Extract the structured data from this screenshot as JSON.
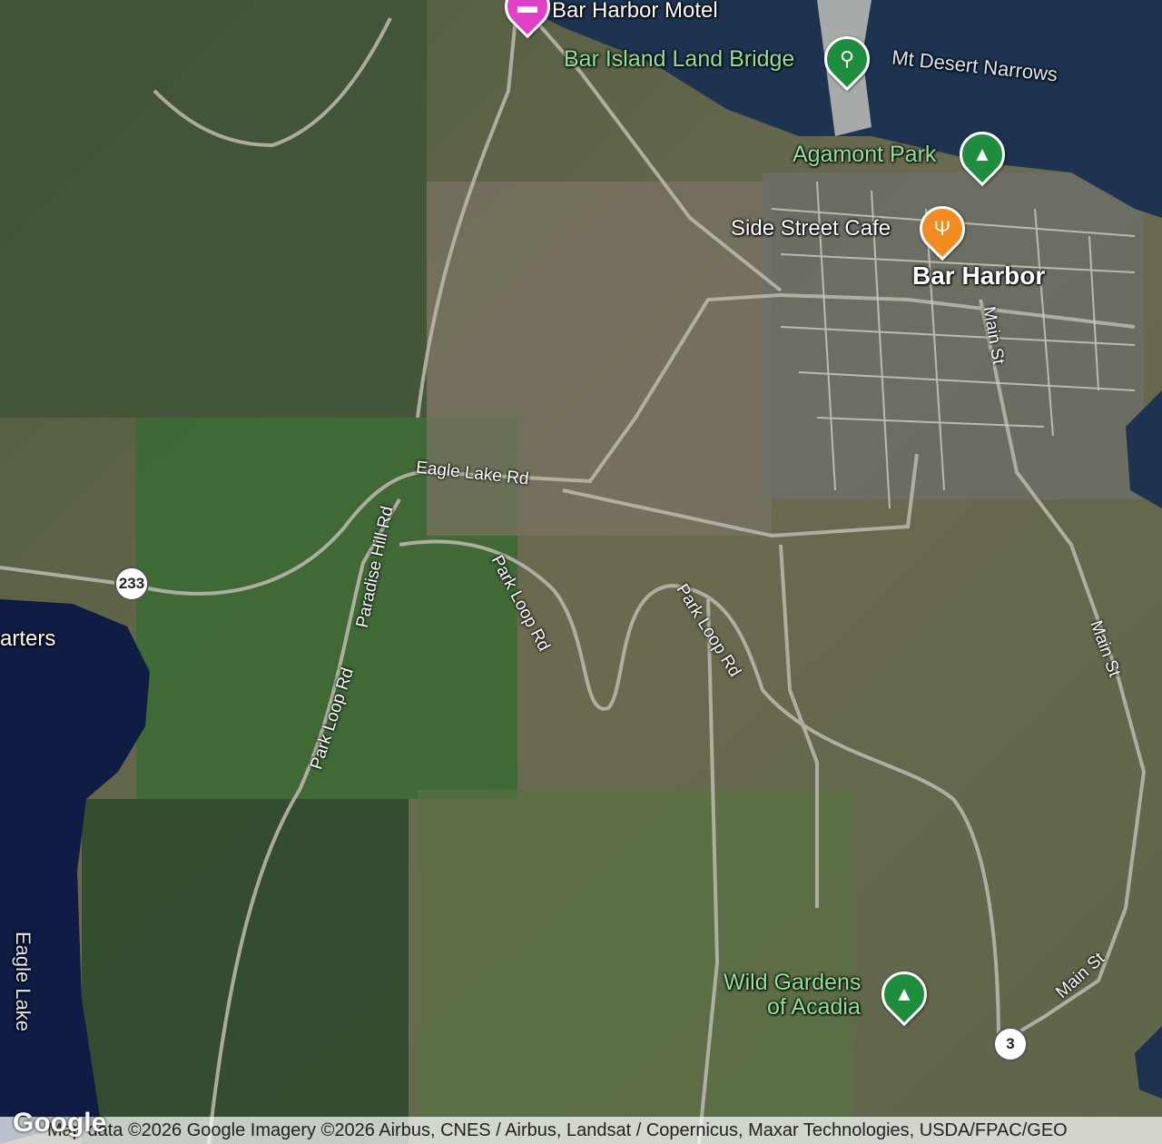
{
  "places": {
    "motel": "Bar Harbor Motel",
    "land_bridge": "Bar Island Land Bridge",
    "narrows": "Mt Desert Narrows",
    "agamont": "Agamont Park",
    "cafe": "Side Street Cafe",
    "town": "Bar Harbor",
    "wild_gardens_1": "Wild Gardens",
    "wild_gardens_2": "of Acadia",
    "headquarters": "arters",
    "eagle_lake": "Eagle Lake"
  },
  "roads": {
    "eagle_lake_rd": "Eagle Lake Rd",
    "paradise_hill_rd": "Paradise Hill Rd",
    "park_loop_1": "Park Loop Rd",
    "park_loop_2": "Park Loop Rd",
    "park_loop_3": "Park Loop Rd",
    "main_st_1": "Main St",
    "main_st_2": "Main St",
    "main_st_3": "Main St",
    "route_233": "233",
    "route_3": "3"
  },
  "icons": {
    "motel": "hotel-icon",
    "land_bridge": "hiking-icon",
    "agamont": "park-icon",
    "cafe": "restaurant-icon",
    "wild_gardens": "park-icon"
  },
  "colors": {
    "hotel_pin": "#e040c8",
    "park_pin": "#1e8e3e",
    "food_pin": "#f28b20"
  },
  "attribution": "Map data ©2026 Google Imagery ©2026 Airbus, CNES / Airbus, Landsat / Copernicus, Maxar Technologies, USDA/FPAC/GEO",
  "logo": "Google"
}
